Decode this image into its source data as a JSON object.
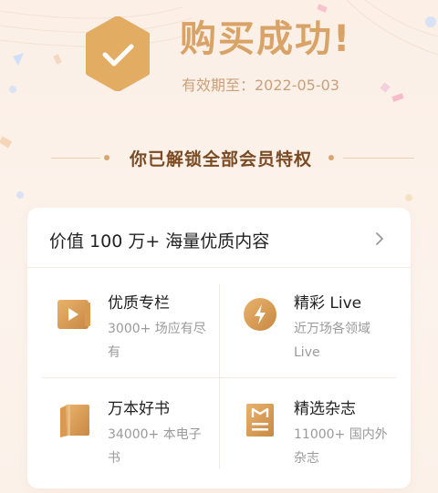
{
  "header": {
    "title": "购买成功!",
    "validity": "有效期至：2022-05-03"
  },
  "unlock": {
    "text": "你已解锁全部会员特权"
  },
  "card": {
    "head": "价值 100 万+ 海量优质内容",
    "features": [
      {
        "title": "优质专栏",
        "desc": "3000+ 场应有尽有",
        "icon": "play-column-icon"
      },
      {
        "title": "精彩 Live",
        "desc": "近万场各领域 Live",
        "icon": "lightning-live-icon"
      },
      {
        "title": "万本好书",
        "desc": "34000+ 本电子书",
        "icon": "book-icon"
      },
      {
        "title": "精选杂志",
        "desc": "11000+ 国内外杂志",
        "icon": "magazine-icon"
      }
    ]
  },
  "colors": {
    "gold": "#d9a266",
    "brown": "#7a4a22",
    "background": "#fbefe6"
  }
}
